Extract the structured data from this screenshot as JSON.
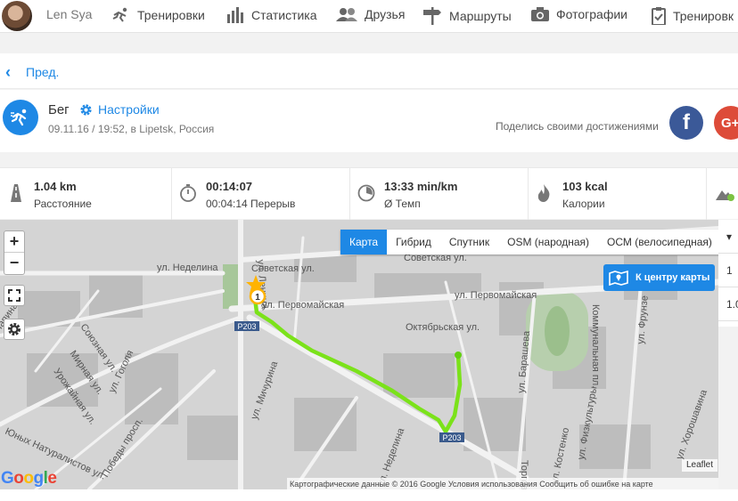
{
  "nav": {
    "user_name": "Len Sya",
    "items": [
      {
        "label": "Тренировки",
        "icon": "running-icon"
      },
      {
        "label": "Статистика",
        "icon": "bar-chart-icon"
      },
      {
        "label": "Друзья",
        "icon": "friends-icon"
      },
      {
        "label": "Маршруты",
        "icon": "signpost-icon"
      },
      {
        "label": "Фотографии",
        "icon": "camera-icon"
      },
      {
        "label": "Тренировк",
        "icon": "clipboard-icon"
      }
    ]
  },
  "back": {
    "label": "Пред."
  },
  "activity": {
    "name": "Бег",
    "settings_label": "Настройки",
    "meta": "09.11.16 / 19:52, в Lipetsk, Россия",
    "share_text": "Поделись своими достижениями",
    "facebook_label": "f",
    "googleplus_label": "G+"
  },
  "stats": [
    {
      "value": "1.04 km",
      "label": "Расстояние",
      "icon": "road-icon"
    },
    {
      "value": "00:14:07",
      "label": "00:04:14 Перерыв",
      "icon": "stopwatch-icon"
    },
    {
      "value": "13:33 min/km",
      "label": "Ø Темп",
      "icon": "pace-gauge-icon"
    },
    {
      "value": "103 kcal",
      "label": "Калории",
      "icon": "flame-icon"
    }
  ],
  "map": {
    "layers": [
      "Карта",
      "Гибрид",
      "Спутник",
      "OSM (народная)",
      "ОСМ (велосипедная)"
    ],
    "active_layer": "Карта",
    "center_button": "К центру карты",
    "zoom_in": "+",
    "zoom_out": "−",
    "start_marker": "1",
    "streets": {
      "nedelina_top": "ул. Неделина",
      "sovetskaya": "Советская ул.",
      "sovetskaya_right": "Советская ул.",
      "pervomayskaya": "ул. Первомайская",
      "pervomayskaya_left": "ул. Первомайская",
      "oktyabrskaya": "Октябрьская ул.",
      "papina": "ул. Папина",
      "soyuznaya": "Союзная ул.",
      "mirnaya": "Мирная ул.",
      "urozhaynaya": "Урожайная ул.",
      "gogolya": "ул. Гоголя",
      "michurina": "ул. Мичурина",
      "nedelina_bottom": "ул. Неделина",
      "pobedy": "Победы просп.",
      "naturalistov": "Юных Натуралистов ул.",
      "barasheva": "ул. Барашева",
      "torgovaya": "Торговая пл.",
      "kommunalnaya": "Коммунальная пл.",
      "frunze": "ул. Фрунзе",
      "fizkultury": "ул. Физкультуры",
      "lenina": "ул. Ленина",
      "kostenko": "ул. Костенко",
      "khorosh": "ул. Хорошавина",
      "r203a": "Р203",
      "r203b": "Р203"
    },
    "google": "Google",
    "attribution": "Картографические данные © 2016 Google    Условия использования    Сообщить об ошибке на карте",
    "leaflet": "Leaflet"
  },
  "right_table": {
    "row1": "1",
    "row2": "1.0"
  },
  "colors": {
    "accent": "#1e88e5",
    "route": "#7be21a",
    "facebook": "#3b5998",
    "googleplus": "#dd4b39"
  }
}
